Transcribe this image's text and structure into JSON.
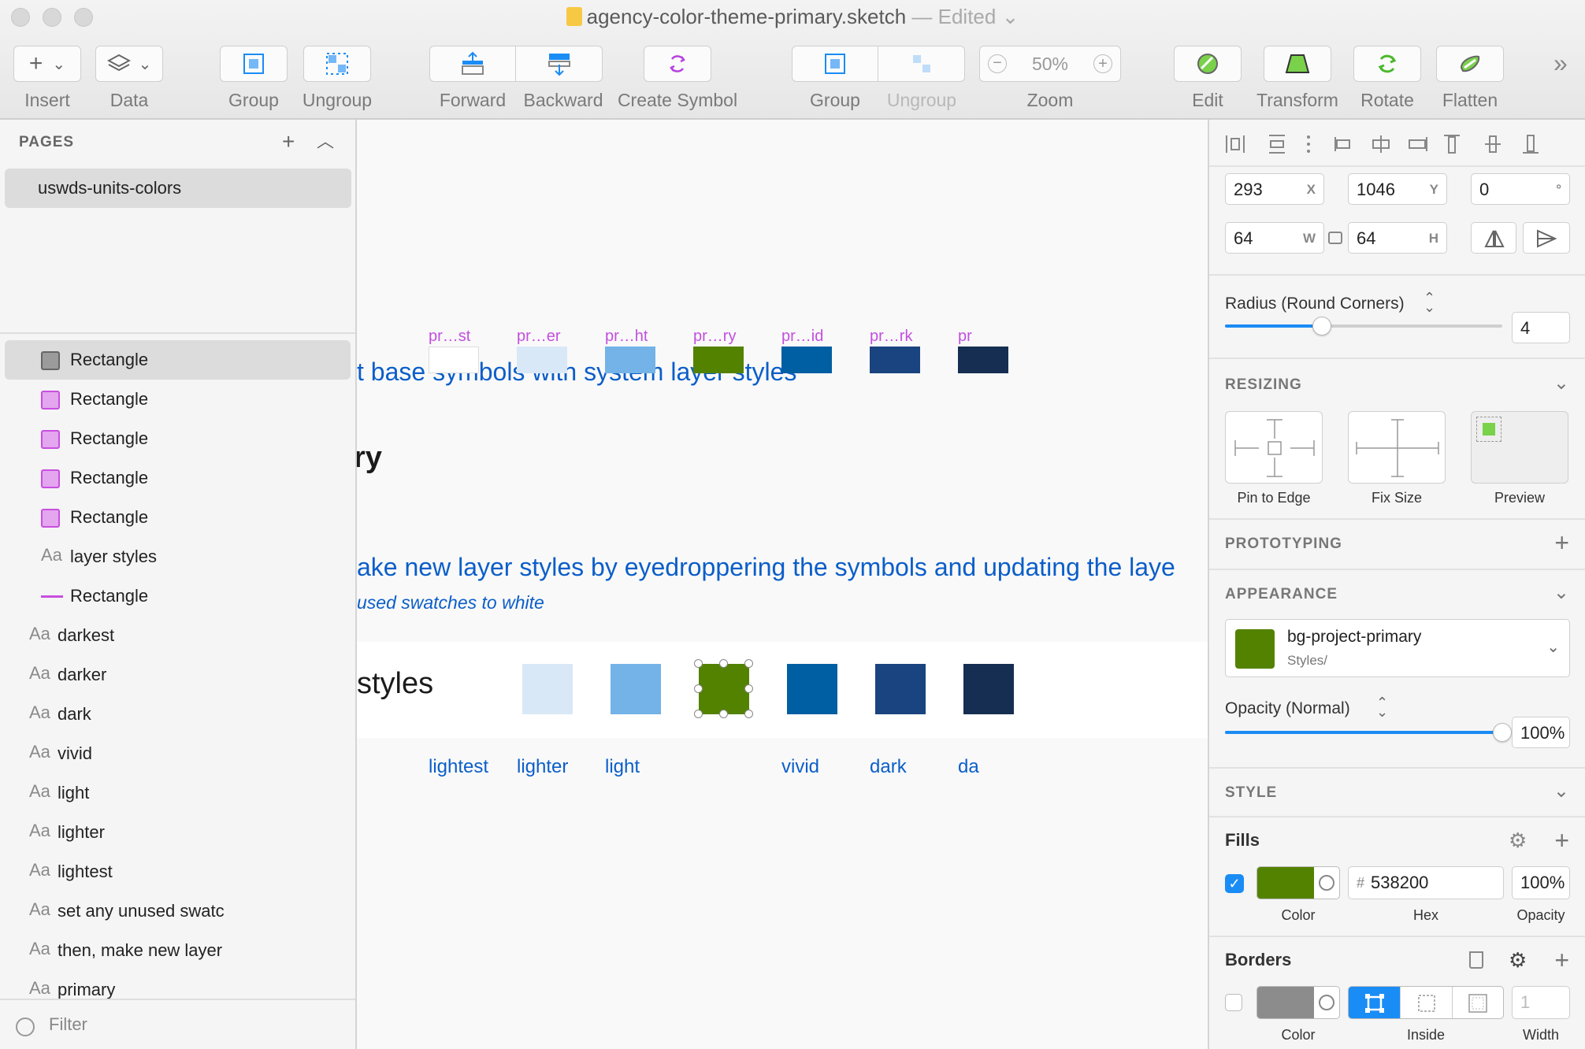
{
  "window": {
    "filename": "agency-color-theme-primary.sketch",
    "separator": "—",
    "status": "Edited"
  },
  "toolbar": {
    "insert": "Insert",
    "data": "Data",
    "group": "Group",
    "ungroup": "Ungroup",
    "forward": "Forward",
    "backward": "Backward",
    "create_symbol": "Create Symbol",
    "group2": "Group",
    "ungroup2": "Ungroup",
    "zoom_value": "50%",
    "zoom_label": "Zoom",
    "edit": "Edit",
    "transform": "Transform",
    "rotate": "Rotate",
    "flatten": "Flatten",
    "overflow": "»"
  },
  "pages": {
    "header": "PAGES",
    "selected": "uswds-units-colors"
  },
  "layers": [
    {
      "type": "rect",
      "label": "Rectangle",
      "selected": true,
      "color": "#9b9b9b"
    },
    {
      "type": "rect",
      "label": "Rectangle",
      "color": "#e3a6ef"
    },
    {
      "type": "rect",
      "label": "Rectangle",
      "color": "#e3a6ef"
    },
    {
      "type": "rect",
      "label": "Rectangle",
      "color": "#e3a6ef"
    },
    {
      "type": "rect",
      "label": "Rectangle",
      "color": "#e3a6ef"
    },
    {
      "type": "text",
      "label": "layer styles",
      "icon": "Aa"
    },
    {
      "type": "line",
      "label": "Rectangle"
    },
    {
      "type": "text-out",
      "label": "darkest",
      "icon": "Aa"
    },
    {
      "type": "text-out",
      "label": "darker",
      "icon": "Aa"
    },
    {
      "type": "text-out",
      "label": "dark",
      "icon": "Aa"
    },
    {
      "type": "text-out",
      "label": "vivid",
      "icon": "Aa"
    },
    {
      "type": "text-out",
      "label": "light",
      "icon": "Aa"
    },
    {
      "type": "text-out",
      "label": "lighter",
      "icon": "Aa"
    },
    {
      "type": "text-out",
      "label": "lightest",
      "icon": "Aa"
    },
    {
      "type": "text-out",
      "label": "set any unused swatc",
      "icon": "Aa"
    },
    {
      "type": "text-out",
      "label": "then, make new layer",
      "icon": "Aa"
    },
    {
      "type": "text-out",
      "label": "primary",
      "icon": "Aa"
    }
  ],
  "filter": {
    "placeholder": "Filter"
  },
  "canvas": {
    "heading1": "t base symbols with system layer styles",
    "row1_label": "ry",
    "symbol_labels": [
      "pr…st",
      "pr…er",
      "pr…ht",
      "pr…ry",
      "pr…id",
      "pr…rk",
      "pr"
    ],
    "symbol_colors": [
      "#ffffff",
      "#d9e8f6",
      "#73b3e7",
      "#538200",
      "#005ea2",
      "#1a4480",
      "#162e51"
    ],
    "heading2": "ake new layer styles by eyedroppering the symbols and updating the laye",
    "subheading2": "used swatches to white",
    "row2_label": "styles",
    "style_colors": [
      "#d9e8f6",
      "#73b3e7",
      "#538200",
      "#005ea2",
      "#1a4480",
      "#162e51"
    ],
    "bottom_labels": [
      "lightest",
      "lighter",
      "light",
      "vivid",
      "dark",
      "da"
    ]
  },
  "inspector": {
    "x": "293",
    "x_unit": "X",
    "y": "1046",
    "y_unit": "Y",
    "rotation": "0",
    "rotation_unit": "°",
    "w": "64",
    "w_unit": "W",
    "h": "64",
    "h_unit": "H",
    "radius_label": "Radius (Round Corners)",
    "radius_value": "4",
    "radius_level": 0.35,
    "resizing": "RESIZING",
    "pin_to_edge": "Pin to Edge",
    "fix_size": "Fix Size",
    "preview": "Preview",
    "prototyping": "PROTOTYPING",
    "appearance": "APPEARANCE",
    "style_name": "bg-project-primary",
    "style_path": "Styles/",
    "style_color": "#538200",
    "opacity_label": "Opacity (Normal)",
    "opacity_value": "100%",
    "opacity_level": 1.0,
    "style_section": "STYLE",
    "fills": "Fills",
    "fill_hash": "#",
    "fill_hex": "538200",
    "fill_opacity": "100%",
    "fill_color_label": "Color",
    "fill_hex_label": "Hex",
    "fill_opacity_label": "Opacity",
    "borders": "Borders",
    "border_width": "1",
    "border_color_label": "Color",
    "border_inside_label": "Inside",
    "border_width_label": "Width"
  }
}
